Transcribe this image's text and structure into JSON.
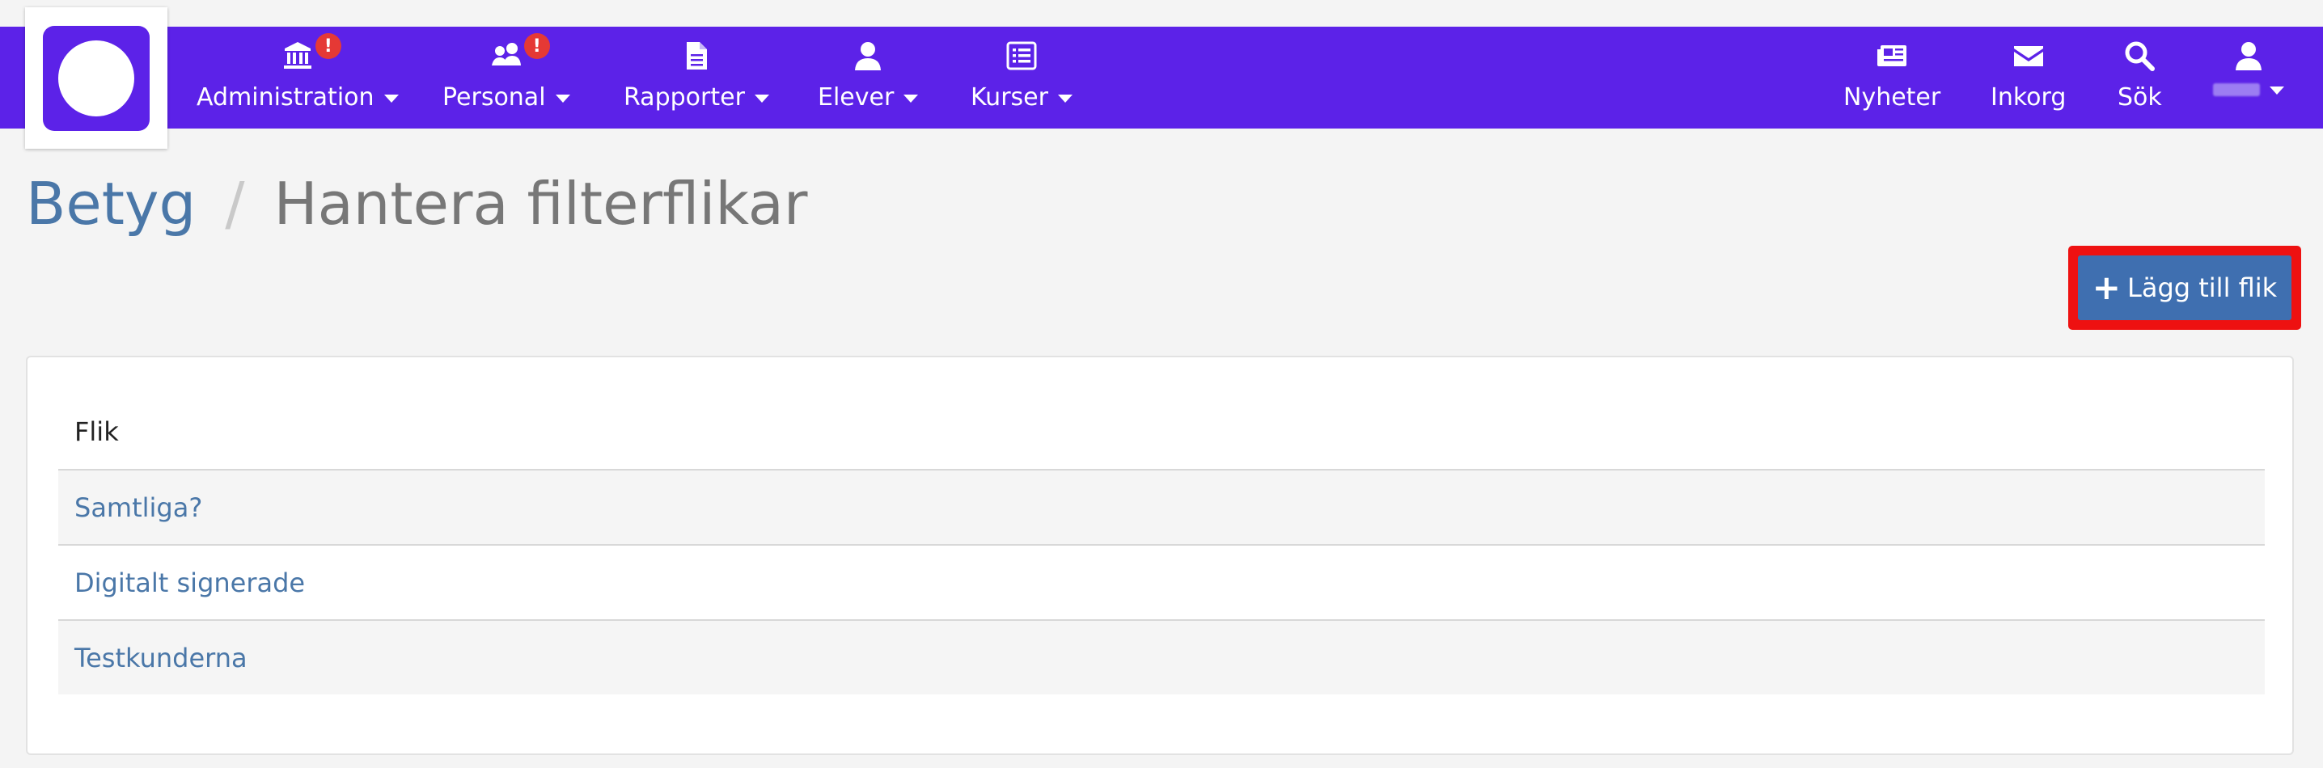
{
  "nav": {
    "items": [
      {
        "label": "Administration",
        "icon": "institution-icon",
        "badge": "!"
      },
      {
        "label": "Personal",
        "icon": "users-icon",
        "badge": "!"
      },
      {
        "label": "Rapporter",
        "icon": "document-icon"
      },
      {
        "label": "Elever",
        "icon": "user-icon"
      },
      {
        "label": "Kurser",
        "icon": "list-icon"
      }
    ],
    "right_items": [
      {
        "label": "Nyheter",
        "icon": "newspaper-icon"
      },
      {
        "label": "Inkorg",
        "icon": "envelope-icon"
      },
      {
        "label": "Sök",
        "icon": "search-icon"
      }
    ],
    "user_icon": "user-icon"
  },
  "breadcrumb": {
    "parent": "Betyg",
    "separator": "/",
    "current": "Hantera filterflikar"
  },
  "add_button": {
    "icon": "plus-icon",
    "label": "Lägg till flik"
  },
  "table": {
    "header": "Flik",
    "rows": [
      "Samtliga?",
      "Digitalt signerade",
      "Testkunderna"
    ]
  },
  "colors": {
    "navbar": "#5c22e8",
    "link": "#4a77a8",
    "button": "#3f6fb0",
    "highlight": "#ee1111",
    "badge": "#e53935"
  }
}
